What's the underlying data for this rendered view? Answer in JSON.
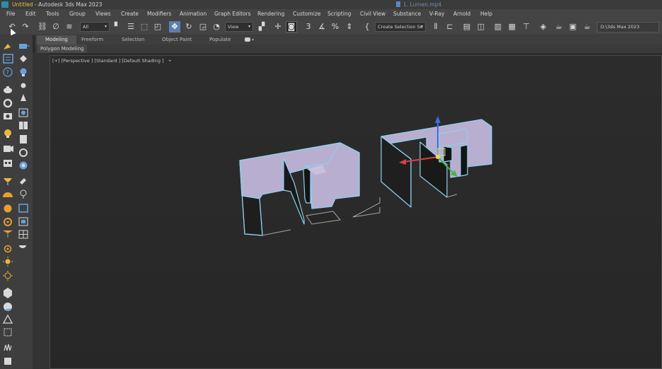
{
  "titlebar": {
    "title_prefix": "Untitled",
    "title_suffix": " - Autodesk 3ds Max 2023",
    "video_label": "1. Lumen.mp4"
  },
  "menu": [
    "File",
    "Edit",
    "Tools",
    "Group",
    "Views",
    "Create",
    "Modifiers",
    "Animation",
    "Graph Editors",
    "Rendering",
    "Customize",
    "Scripting",
    "Civil View",
    "Substance",
    "V-Ray",
    "Arnold",
    "Help"
  ],
  "toolbar": {
    "selection_filter": "All",
    "reference_coord": "View",
    "angle_snap_label": "3",
    "create_selection_set": "Create Selection Se",
    "project_path": "D:\\3ds Max 2023"
  },
  "ribbon": {
    "tabs": [
      "Modeling",
      "Freeform",
      "Selection",
      "Object Paint",
      "Populate"
    ],
    "active_tab": "Modeling",
    "sub_label": "Polygon Modeling"
  },
  "viewport": {
    "label": "[+] [Perspective ] [Standard ] [Default Shading ]"
  },
  "colors": {
    "wall_face": "#b8aed0",
    "wall_edge": "#8fd0ec",
    "active_button": "#5b7fb2",
    "gizmo_x": "#d94040",
    "gizmo_y": "#4ab04a",
    "gizmo_z": "#3a6ee8"
  }
}
